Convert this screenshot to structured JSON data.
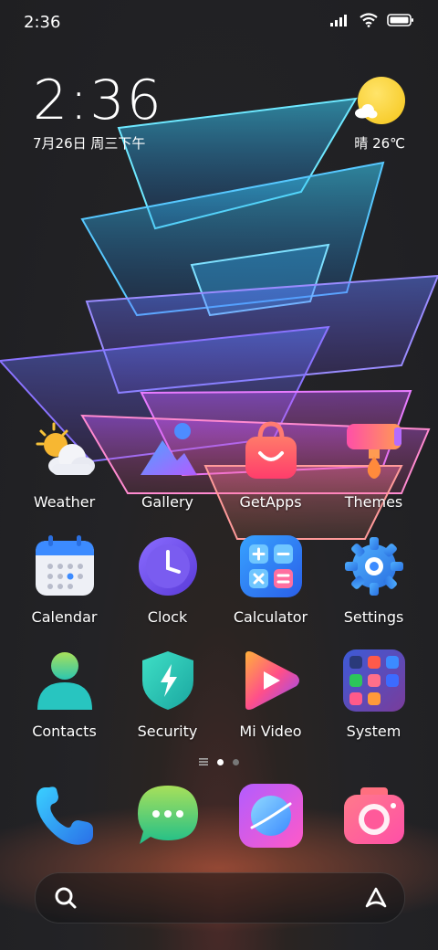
{
  "status_bar": {
    "time": "2:36"
  },
  "clock_widget": {
    "time": "2:36",
    "date": "7月26日 周三下午"
  },
  "weather_widget": {
    "text": "晴 26℃",
    "icon": "sunny-cloud-icon"
  },
  "apps_row1": [
    {
      "label": "Weather",
      "icon": "weather-icon"
    },
    {
      "label": "Gallery",
      "icon": "gallery-icon"
    },
    {
      "label": "GetApps",
      "icon": "getapps-icon"
    },
    {
      "label": "Themes",
      "icon": "themes-icon"
    }
  ],
  "apps_row2": [
    {
      "label": "Calendar",
      "icon": "calendar-icon"
    },
    {
      "label": "Clock",
      "icon": "clock-icon"
    },
    {
      "label": "Calculator",
      "icon": "calculator-icon"
    },
    {
      "label": "Settings",
      "icon": "settings-icon"
    }
  ],
  "apps_row3": [
    {
      "label": "Contacts",
      "icon": "contacts-icon"
    },
    {
      "label": "Security",
      "icon": "security-icon"
    },
    {
      "label": "Mi Video",
      "icon": "mi-video-icon"
    },
    {
      "label": "System",
      "icon": "system-folder-icon"
    }
  ],
  "dock": [
    {
      "icon": "phone-icon"
    },
    {
      "icon": "messages-icon"
    },
    {
      "icon": "browser-icon"
    },
    {
      "icon": "camera-icon"
    }
  ],
  "page_indicator": {
    "pages": 2,
    "current": 1
  }
}
